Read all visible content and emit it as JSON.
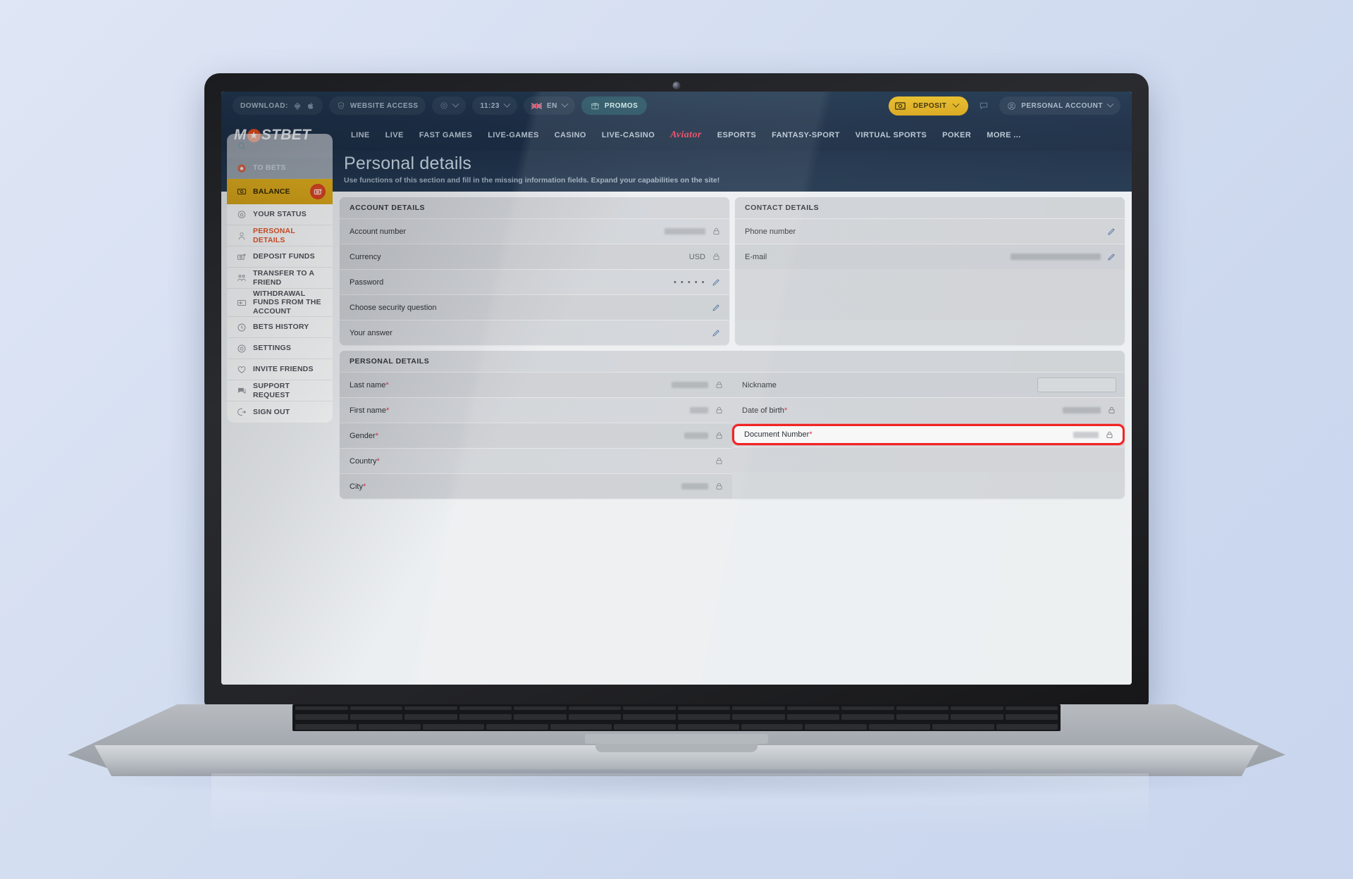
{
  "topbar": {
    "download_label": "DOWNLOAD:",
    "android_icon": "android-icon",
    "apple_icon": "apple-icon",
    "website_access": "WEBSITE ACCESS",
    "theme_icon": "theme-toggle-icon",
    "time": "11:23",
    "language": "EN",
    "flag": "uk-flag-icon",
    "promos": "PROMOS",
    "deposit": "DEPOSIT",
    "chat_icon": "chat-icon",
    "personal_account": "PERSONAL ACCOUNT"
  },
  "brand": {
    "name_before": "M",
    "star": "★",
    "name_after": "STBET"
  },
  "nav": {
    "items": [
      {
        "label": "LINE"
      },
      {
        "label": "LIVE"
      },
      {
        "label": "FAST GAMES"
      },
      {
        "label": "LIVE-GAMES"
      },
      {
        "label": "CASINO"
      },
      {
        "label": "LIVE-CASINO"
      },
      {
        "label": "Aviator"
      },
      {
        "label": "ESPORTS"
      },
      {
        "label": "FANTASY-SPORT"
      },
      {
        "label": "VIRTUAL SPORTS"
      },
      {
        "label": "POKER"
      },
      {
        "label": "MORE ..."
      }
    ]
  },
  "hero": {
    "title": "Personal details",
    "subtitle": "Use functions of this section and fill in the missing information fields. Expand your capabilities on the site!"
  },
  "sidebar": {
    "items": [
      {
        "label": "TO BETS",
        "icon": "star-icon"
      },
      {
        "label": "BALANCE",
        "icon": "money-icon"
      },
      {
        "label": "YOUR STATUS",
        "icon": "gear-icon"
      },
      {
        "label": "PERSONAL DETAILS",
        "icon": "user-icon"
      },
      {
        "label": "DEPOSIT FUNDS",
        "icon": "money-plus-icon"
      },
      {
        "label": "TRANSFER TO A FRIEND",
        "icon": "people-icon"
      },
      {
        "label": "WITHDRAWAL FUNDS FROM THE ACCOUNT",
        "icon": "withdraw-icon"
      },
      {
        "label": "BETS HISTORY",
        "icon": "clock-icon"
      },
      {
        "label": "SETTINGS",
        "icon": "settings-icon"
      },
      {
        "label": "INVITE FRIENDS",
        "icon": "heart-icon"
      },
      {
        "label": "SUPPORT REQUEST",
        "icon": "chat-icon"
      },
      {
        "label": "SIGN OUT",
        "icon": "logout-icon"
      }
    ]
  },
  "account_details": {
    "heading": "ACCOUNT DETAILS",
    "rows": [
      {
        "label": "Account number",
        "value": "",
        "redacted": true,
        "action": "lock-icon"
      },
      {
        "label": "Currency",
        "value": "USD",
        "redacted": false,
        "action": "lock-icon"
      },
      {
        "label": "Password",
        "value": "• • • • •",
        "redacted": false,
        "action": "pencil-icon"
      },
      {
        "label": "Choose security question",
        "value": "",
        "redacted": false,
        "action": "pencil-icon"
      },
      {
        "label": "Your answer",
        "value": "",
        "redacted": false,
        "action": "pencil-icon"
      }
    ]
  },
  "contact_details": {
    "heading": "CONTACT DETAILS",
    "rows": [
      {
        "label": "Phone number",
        "value": "",
        "redacted": false,
        "action": "pencil-icon"
      },
      {
        "label": "E-mail",
        "value": "",
        "redacted": true,
        "action": "pencil-icon"
      }
    ]
  },
  "personal_details": {
    "heading": "PERSONAL DETAILS",
    "left_rows": [
      {
        "label": "Last name",
        "required": "*",
        "redacted": true,
        "action": "lock-icon"
      },
      {
        "label": "First name",
        "required": "*",
        "redacted": true,
        "action": "lock-icon"
      },
      {
        "label": "Gender",
        "required": "*",
        "redacted": true,
        "action": "lock-icon"
      },
      {
        "label": "Country",
        "required": "*",
        "redacted": false,
        "action": "lock-icon"
      },
      {
        "label": "City",
        "required": "*",
        "redacted": true,
        "action": "lock-icon"
      }
    ],
    "right_rows": [
      {
        "label": "Nickname",
        "required": "",
        "input": true,
        "action": ""
      },
      {
        "label": "Date of birth",
        "required": "*",
        "redacted": true,
        "action": "lock-icon"
      },
      {
        "label": "Document Number",
        "required": "*",
        "redacted": true,
        "action": "lock-icon",
        "highlighted": true
      }
    ]
  },
  "colors": {
    "accent_yellow": "#e0ae1b",
    "accent_orange": "#e2542a",
    "highlight_red": "#f02525",
    "nav_blue": "#1d3048",
    "panel_grey": "#d3d6d9"
  }
}
